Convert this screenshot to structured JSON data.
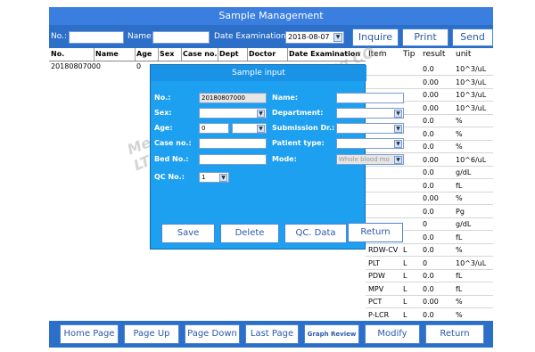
{
  "window": {
    "title": "Sample Management"
  },
  "filter": {
    "no_label": "No.:",
    "name_label": "Name:",
    "date_label": "Date Examination:",
    "date_value": "2018-08-07",
    "inquire": "Inquire",
    "print": "Print",
    "send": "Send"
  },
  "list": {
    "headers": [
      "No.",
      "Name",
      "Age",
      "Sex",
      "Case no.",
      "Dept",
      "Doctor",
      "Date Examination"
    ],
    "rows": [
      {
        "no": "20180807000",
        "age": "0"
      }
    ]
  },
  "results": {
    "headers": [
      "Item",
      "Tip",
      "result",
      "unit"
    ],
    "rows": [
      {
        "item": "",
        "tip": "",
        "result": "0.0",
        "unit": "10^3/uL"
      },
      {
        "item": "",
        "tip": "",
        "result": "0.00",
        "unit": "10^3/uL"
      },
      {
        "item": "",
        "tip": "",
        "result": "0.00",
        "unit": "10^3/uL"
      },
      {
        "item": "",
        "tip": "",
        "result": "0.00",
        "unit": "10^3/uL"
      },
      {
        "item": "",
        "tip": "",
        "result": "0.0",
        "unit": "%"
      },
      {
        "item": "",
        "tip": "",
        "result": "0.0",
        "unit": "%"
      },
      {
        "item": "",
        "tip": "",
        "result": "0.0",
        "unit": "%"
      },
      {
        "item": "",
        "tip": "",
        "result": "0.00",
        "unit": "10^6/uL"
      },
      {
        "item": "",
        "tip": "",
        "result": "0.0",
        "unit": "g/dL"
      },
      {
        "item": "",
        "tip": "",
        "result": "0.0",
        "unit": "fL"
      },
      {
        "item": "",
        "tip": "",
        "result": "0.00",
        "unit": "%"
      },
      {
        "item": "",
        "tip": "",
        "result": "0.0",
        "unit": "Pg"
      },
      {
        "item": "",
        "tip": "",
        "result": "0",
        "unit": "g/dL"
      },
      {
        "item": "",
        "tip": "",
        "result": "0.0",
        "unit": "fL"
      },
      {
        "item": "RDW-CV",
        "tip": "L",
        "result": "0.0",
        "unit": "%"
      },
      {
        "item": "PLT",
        "tip": "L",
        "result": "0",
        "unit": "10^3/uL"
      },
      {
        "item": "PDW",
        "tip": "L",
        "result": "0.0",
        "unit": "fL"
      },
      {
        "item": "MPV",
        "tip": "L",
        "result": "0.0",
        "unit": "fL"
      },
      {
        "item": "PCT",
        "tip": "L",
        "result": "0.00",
        "unit": "%"
      },
      {
        "item": "P-LCR",
        "tip": "L",
        "result": "0.0",
        "unit": "%"
      }
    ]
  },
  "dialog": {
    "title": "Sample input",
    "no_label": "No.:",
    "no_value": "20180807000",
    "sex_label": "Sex:",
    "age_label": "Age:",
    "age_value": "0",
    "case_label": "Case no.:",
    "bed_label": "Bed No.:",
    "qc_label": "QC No.:",
    "qc_value": "1",
    "name_label": "Name:",
    "dept_label": "Department:",
    "submission_label": "Submission Dr.:",
    "patient_type_label": "Patient type:",
    "mode_label": "Mode:",
    "mode_value": "Whole blood mo",
    "save": "Save",
    "delete": "Delete",
    "qc_data": "QC. Data",
    "return": "Return"
  },
  "bottom": {
    "home": "Home Page",
    "page_up": "Page Up",
    "page_down": "Page Down",
    "last_page": "Last Page",
    "graph_review": "Graph Review",
    "modify": "Modify",
    "return": "Return"
  },
  "watermark": "Medbes International Trading CO., LTD"
}
